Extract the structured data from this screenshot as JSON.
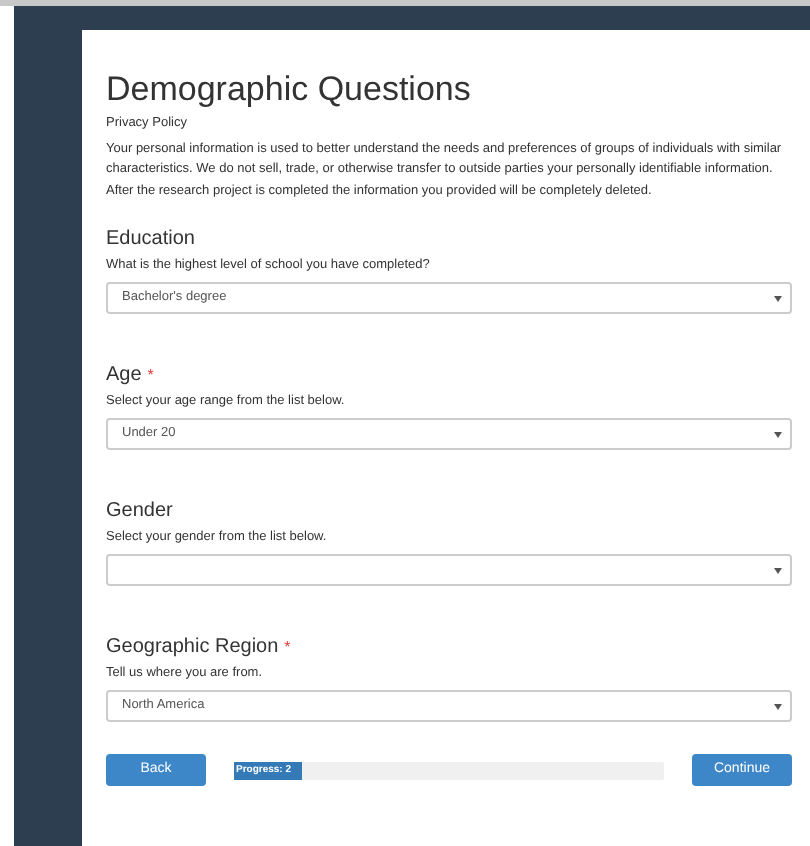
{
  "title": "Demographic Questions",
  "privacy_link": "Privacy Policy",
  "intro": "Your personal information is used to better understand the needs and preferences of groups of individuals with similar characteristics. We do not sell, trade, or otherwise transfer to outside parties your personally identifiable information. After the research project is completed the information you provided will be completely deleted.",
  "questions": [
    {
      "label": "Education",
      "required": false,
      "hint": "What is the highest level of school you have completed?",
      "value": "Bachelor's degree"
    },
    {
      "label": "Age",
      "required": true,
      "hint": "Select your age range from the list below.",
      "value": "Under 20"
    },
    {
      "label": "Gender",
      "required": false,
      "hint": "Select your gender from the list below."
    },
    {
      "label": "Geographic Region",
      "required": true,
      "hint": "Tell us where you are from.",
      "value": "North America"
    }
  ],
  "required_mark": "*",
  "back_button": "Back",
  "progress": {
    "text": "Progress: 2",
    "level": 0.16
  },
  "continue_button": "Continue"
}
